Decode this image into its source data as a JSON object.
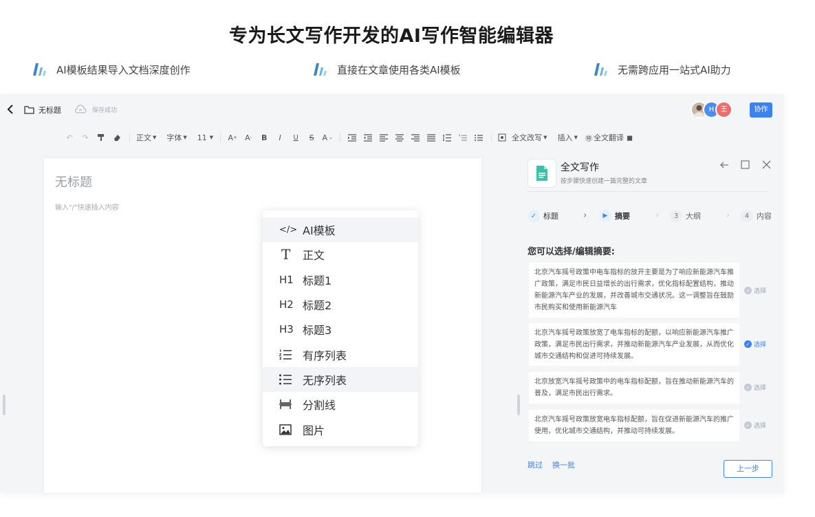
{
  "hero": {
    "title": "专为长文写作开发的AI写作智能编辑器",
    "features": [
      "AI模板结果导入文档深度创作",
      "直接在文章使用各类AI模板",
      "无需跨应用一站式AI助力"
    ]
  },
  "topbar": {
    "doc_name": "无标题",
    "save_status": "保存成功",
    "avatar_initial_1": "H",
    "avatar_initial_2": "王",
    "collab_label": "协作"
  },
  "toolbar": {
    "paragraph_style": "正文",
    "font_family": "字体",
    "font_size": "11",
    "bold": "B",
    "italic": "I",
    "underline": "U",
    "strike": "S",
    "font_color": "A",
    "rewrite_label": "全文改写",
    "insert_label": "插入",
    "translate_label": "全文翻译"
  },
  "editor": {
    "title_placeholder": "无标题",
    "hint": "输入\"/\"快速插入内容"
  },
  "slash_menu": {
    "items": [
      {
        "icon": "</>",
        "label": "AI模板"
      },
      {
        "icon": "T",
        "label": "正文"
      },
      {
        "icon": "H1",
        "label": "标题1"
      },
      {
        "icon": "H2",
        "label": "标题2"
      },
      {
        "icon": "H3",
        "label": "标题3"
      },
      {
        "icon": "ordered-list-icon",
        "label": "有序列表"
      },
      {
        "icon": "bullet-list-icon",
        "label": "无序列表"
      },
      {
        "icon": "divider-icon",
        "label": "分割线"
      },
      {
        "icon": "image-icon",
        "label": "图片"
      }
    ]
  },
  "panel": {
    "title": "全文写作",
    "subtitle": "按步骤快速创建一篇完整的文章",
    "steps": [
      {
        "num": "✓",
        "label": "标题"
      },
      {
        "num": "▶",
        "label": "摘要"
      },
      {
        "num": "3",
        "label": "大纲"
      },
      {
        "num": "4",
        "label": "内容"
      }
    ],
    "choose_label": "您可以选择/编辑摘要:",
    "pick_label": "选择",
    "summaries": [
      "北京汽车摇号政策中电车指标的放开主要是为了响应新能源汽车推广政策，满足市民日益增长的出行需求，优化指标配置结构，推动新能源汽车产业的发展，并改善城市交通状况。这一调整旨在鼓励市民购买和使用新能源汽车",
      "北京汽车摇号政策放宽了电车指标的配额，以响应新能源汽车推广政策，满足市民出行需求，并推动新能源汽车产业发展，从而优化城市交通结构和促进可持续发展。",
      "北京放宽汽车摇号政策中的电车指标配额，旨在推动新能源汽车的普及，满足市民出行需求。",
      "北京汽车摇号政策放宽电车指标配额，旨在促进新能源汽车的推广使用，优化城市交通结构，并推动可持续发展。"
    ],
    "skip_label": "跳过",
    "refresh_label": "换一批",
    "prev_label": "上一步"
  },
  "colors": {
    "accent": "#3b82f6",
    "feature_icon": "#4aa3df"
  }
}
